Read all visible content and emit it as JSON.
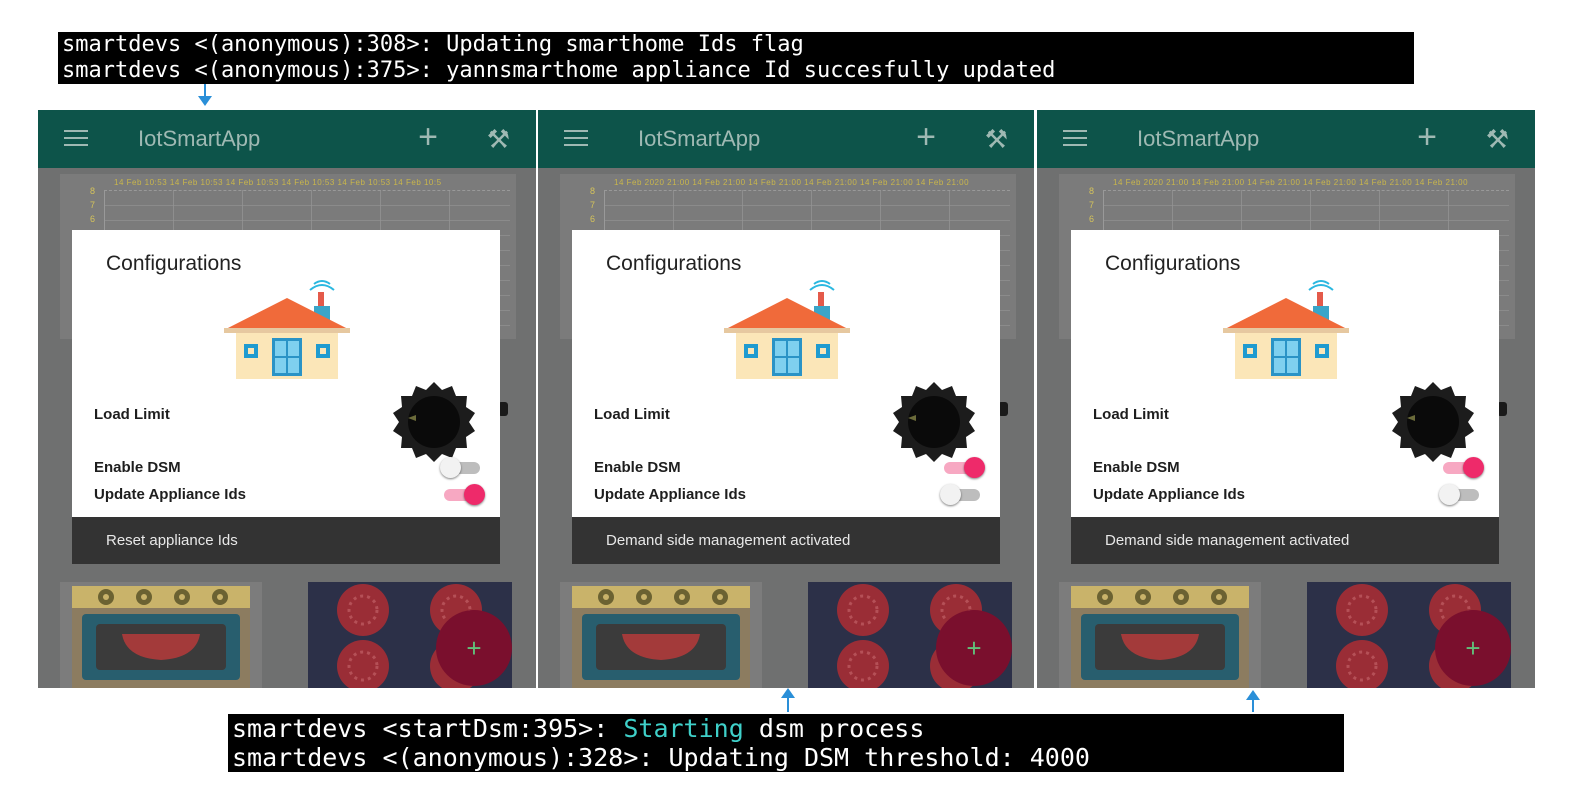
{
  "terminal_top": {
    "lines": [
      "smartdevs <(anonymous):308>: Updating smarthome Ids flag",
      "smartdevs <(anonymous):375>: yannsmarthome appliance Id succesfully updated"
    ]
  },
  "terminal_bottom": {
    "line1_prefix": "smartdevs <startDsm:395>: ",
    "line1_highlight": "Starting",
    "line1_suffix": " dsm process",
    "line2": "smartdevs <(anonymous):328>: Updating DSM threshold: 4000",
    "highlight_color": "#3fd0c9"
  },
  "colors": {
    "appbar": "#0d544a",
    "toggle_on": "#ee2a6a",
    "fab": "#7a0f2d",
    "arrow": "#2a8fd8"
  },
  "screens": [
    {
      "app_title": "IotSmartApp",
      "chart_ticks": "14 Feb 10:53   14 Feb 10:53   14 Feb 10:53   14 Feb 10:53   14 Feb 10:53   14 Feb 10:5",
      "chart_y_labels": [
        "8",
        "7",
        "6"
      ],
      "dialog_title": "Configurations",
      "load_limit_label": "Load Limit",
      "enable_dsm_label": "Enable DSM",
      "update_ids_label": "Update Appliance Ids",
      "enable_dsm_on": false,
      "update_ids_on": true,
      "snackbar": "Reset appliance Ids",
      "fab_label": "+"
    },
    {
      "app_title": "IotSmartApp",
      "chart_ticks": "14 Feb 2020 21:00   14 Feb 21:00   14 Feb 21:00   14 Feb 21:00   14 Feb 21:00   14 Feb 21:00",
      "chart_y_labels": [
        "8",
        "7",
        "6"
      ],
      "dialog_title": "Configurations",
      "load_limit_label": "Load Limit",
      "enable_dsm_label": "Enable DSM",
      "update_ids_label": "Update Appliance Ids",
      "enable_dsm_on": true,
      "update_ids_on": false,
      "snackbar": "Demand side management activated",
      "fab_label": "+"
    },
    {
      "app_title": "IotSmartApp",
      "chart_ticks": "14 Feb 2020 21:00   14 Feb 21:00   14 Feb 21:00   14 Feb 21:00   14 Feb 21:00   14 Feb 21:00",
      "chart_y_labels": [
        "8",
        "7",
        "6"
      ],
      "dialog_title": "Configurations",
      "load_limit_label": "Load Limit",
      "enable_dsm_label": "Enable DSM",
      "update_ids_label": "Update Appliance Ids",
      "enable_dsm_on": true,
      "update_ids_on": false,
      "snackbar": "Demand side management activated",
      "fab_label": "+"
    }
  ]
}
